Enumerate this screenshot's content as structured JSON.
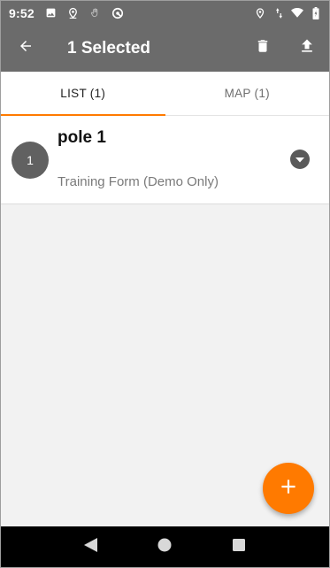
{
  "status_bar": {
    "time": "9:52",
    "left_icons": [
      "image-icon",
      "location-pin-icon",
      "hand-icon",
      "sync-icon"
    ],
    "right_icons": [
      "location-pin-icon",
      "data-arrows-icon",
      "wifi-icon",
      "battery-icon"
    ]
  },
  "app_bar": {
    "title": "1 Selected",
    "background": "#6b6b6b"
  },
  "tabs": [
    {
      "label": "LIST (1)",
      "active": true
    },
    {
      "label": "MAP (1)",
      "active": false
    }
  ],
  "list": {
    "items": [
      {
        "number": "1",
        "title": "pole 1",
        "subtitle": "Training Form (Demo Only)"
      }
    ]
  },
  "colors": {
    "accent": "#ff7a00",
    "toolbar": "#6b6b6b",
    "background": "#f2f2f2"
  }
}
